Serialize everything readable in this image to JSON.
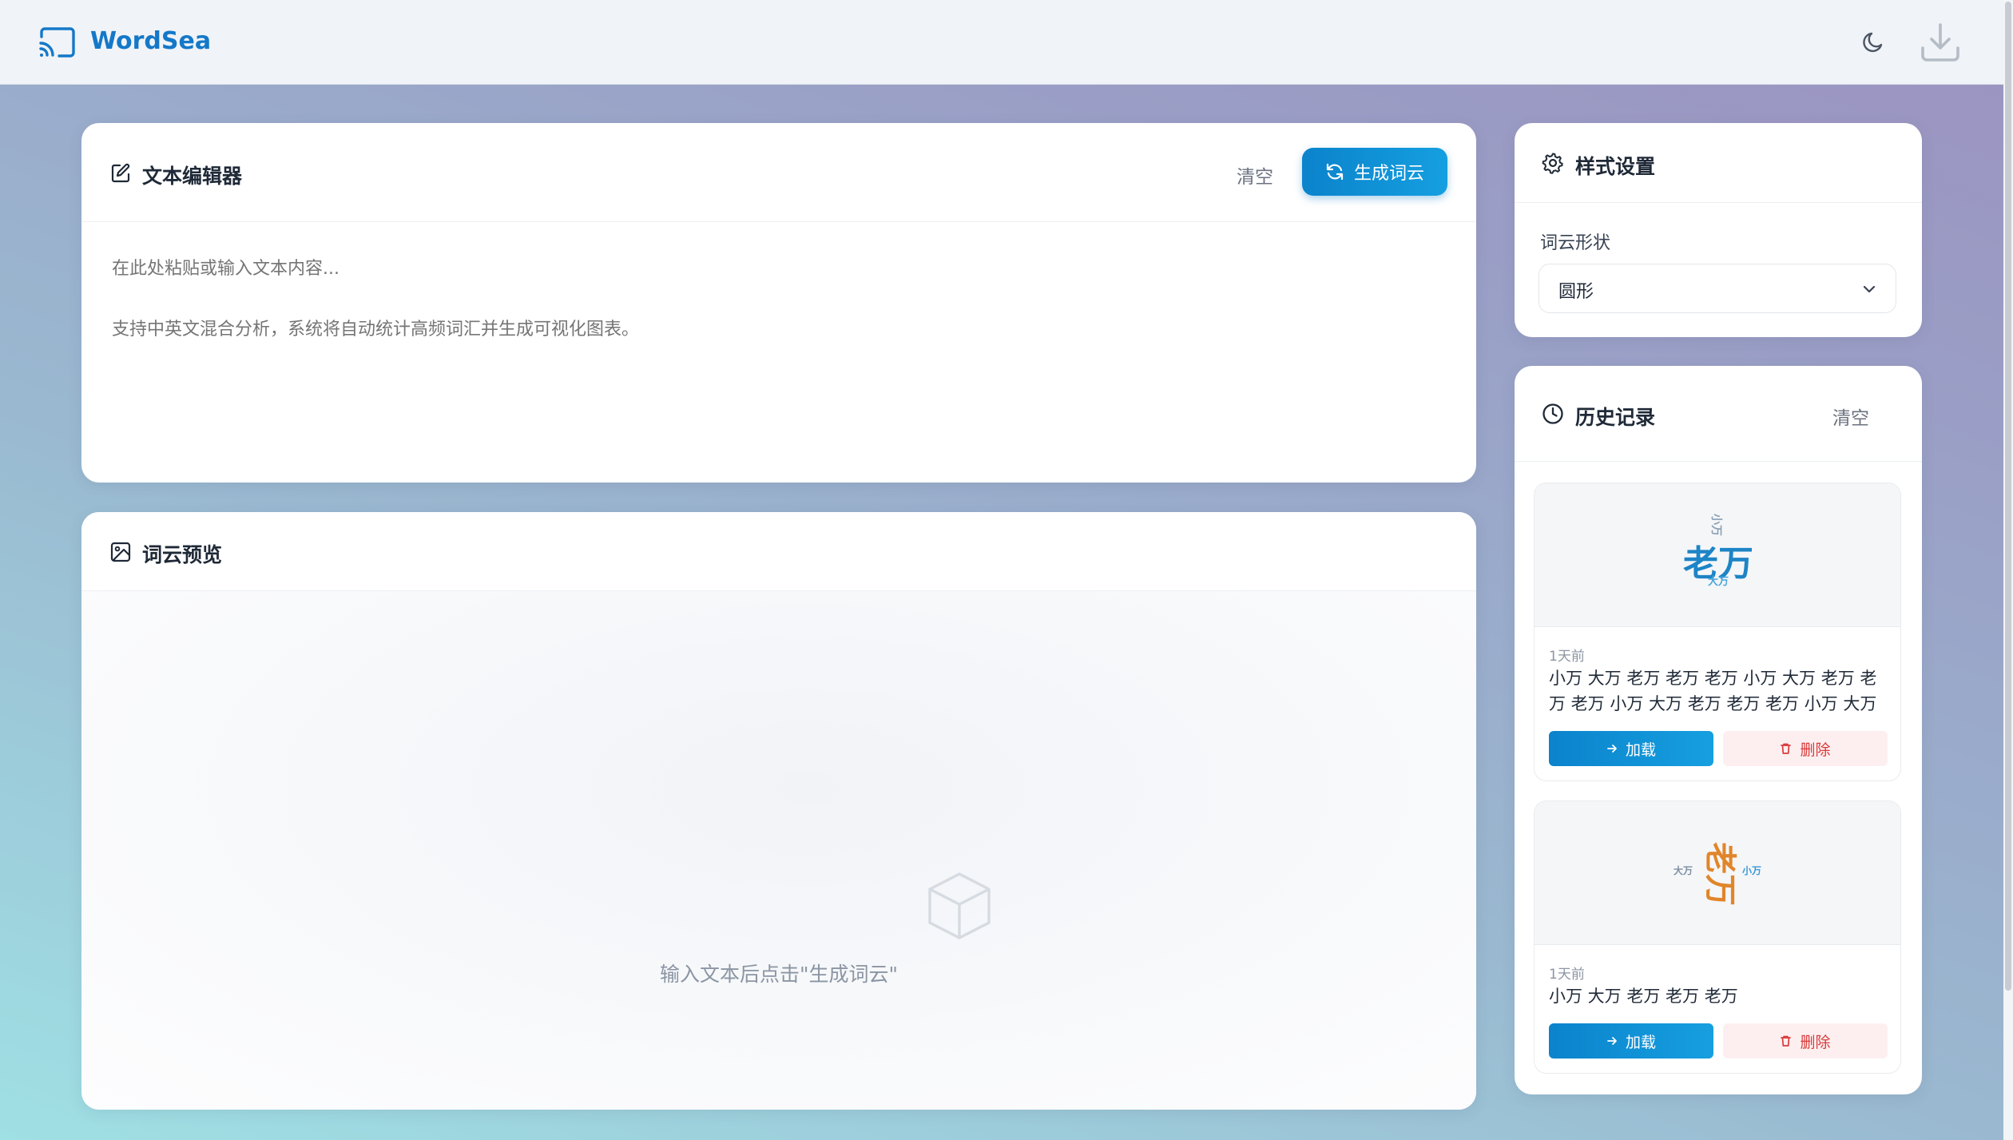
{
  "app": {
    "name": "WordSea",
    "accent": "#1478c8"
  },
  "header": {
    "icons": [
      "cast-icon",
      "moon-icon",
      "download-icon"
    ]
  },
  "editor": {
    "title": "文本编辑器",
    "clear_label": "清空",
    "generate_label": "生成词云",
    "placeholder": "在此处粘贴或输入文本内容...\n\n支持中英文混合分析，系统将自动统计高频词汇并生成可视化图表。"
  },
  "preview": {
    "title": "词云预览",
    "empty_text": "输入文本后点击\"生成词云\""
  },
  "style_settings": {
    "title": "样式设置",
    "shape_label": "词云形状",
    "shape_value": "圆形"
  },
  "history": {
    "title": "历史记录",
    "clear_label": "清空",
    "items": [
      {
        "time": "1天前",
        "text": "小万 大万 老万 老万 老万 小万 大万 老万 老万 老万 小万 大万 老万 老万 老万 小万 大万 老万 老...",
        "load_label": "加载",
        "delete_label": "删除",
        "thumb_words": {
          "main": "老万",
          "small_top": "小万",
          "small_bottom": "大万"
        },
        "thumb_colors": {
          "main": "#1d84c6",
          "small_top": "#8aa0b5",
          "small_bottom": "#4aa6d8"
        }
      },
      {
        "time": "1天前",
        "text": "小万 大万 老万 老万 老万",
        "load_label": "加载",
        "delete_label": "删除",
        "thumb_words": {
          "main": "老万",
          "left": "大万",
          "right": "小万"
        },
        "thumb_colors": {
          "main": "#e0862a",
          "left": "#7e8fa3",
          "right": "#3b9ad8"
        }
      }
    ]
  }
}
